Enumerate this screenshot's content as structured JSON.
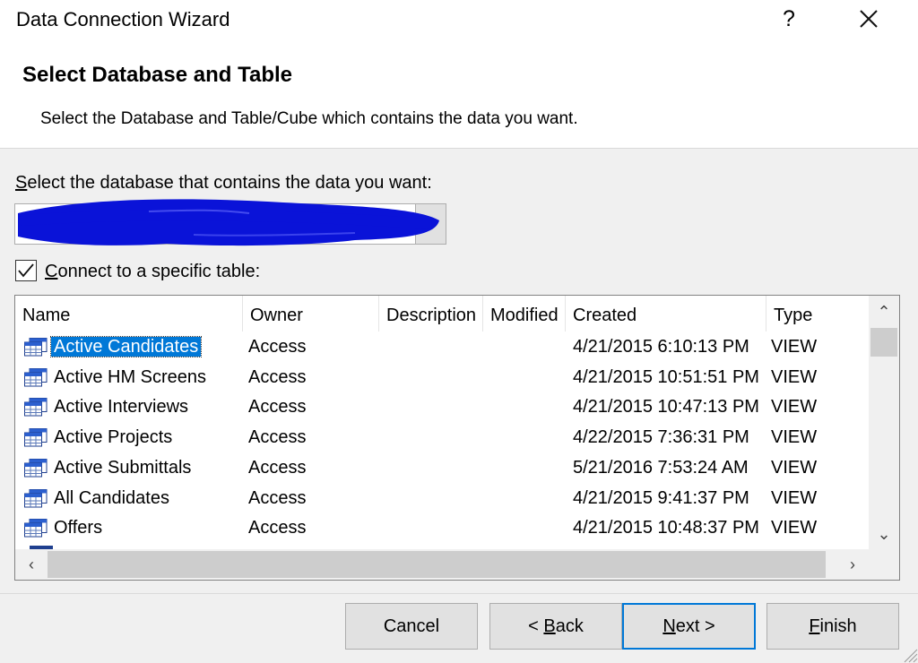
{
  "window": {
    "title": "Data Connection Wizard",
    "help_label": "?"
  },
  "header": {
    "title": "Select Database and Table",
    "subtitle": "Select the Database and Table/Cube which contains the data you want."
  },
  "database": {
    "label_underlined": "S",
    "label_rest": "elect the database that contains the data you want:",
    "selected_value": "",
    "redacted": true
  },
  "connect_specific": {
    "checked": true,
    "label_underlined": "C",
    "label_rest": "onnect to a specific table:"
  },
  "table_list": {
    "columns": [
      "Name",
      "Owner",
      "Description",
      "Modified",
      "Created",
      "Type"
    ],
    "rows": [
      {
        "name": "Active Candidates",
        "owner": "Access",
        "description": "",
        "modified": "",
        "created": "4/21/2015 6:10:13 PM",
        "type": "VIEW",
        "selected": true
      },
      {
        "name": "Active HM Screens",
        "owner": "Access",
        "description": "",
        "modified": "",
        "created": "4/21/2015 10:51:51 PM",
        "type": "VIEW"
      },
      {
        "name": "Active Interviews",
        "owner": "Access",
        "description": "",
        "modified": "",
        "created": "4/21/2015 10:47:13 PM",
        "type": "VIEW"
      },
      {
        "name": "Active Projects",
        "owner": "Access",
        "description": "",
        "modified": "",
        "created": "4/22/2015 7:36:31 PM",
        "type": "VIEW"
      },
      {
        "name": "Active Submittals",
        "owner": "Access",
        "description": "",
        "modified": "",
        "created": "5/21/2016 7:53:24 AM",
        "type": "VIEW"
      },
      {
        "name": "All Candidates",
        "owner": "Access",
        "description": "",
        "modified": "",
        "created": "4/21/2015 9:41:37 PM",
        "type": "VIEW"
      },
      {
        "name": "Offers",
        "owner": "Access",
        "description": "",
        "modified": "",
        "created": "4/21/2015 10:48:37 PM",
        "type": "VIEW"
      }
    ],
    "row_icon": "table-view-icon"
  },
  "buttons": {
    "cancel": {
      "label": "Cancel"
    },
    "back": {
      "prefix": "< ",
      "underlined": "B",
      "rest": "ack"
    },
    "next": {
      "underlined": "N",
      "rest": "ext >"
    },
    "finish": {
      "underlined": "F",
      "rest": "inish"
    }
  },
  "colors": {
    "selection": "#0078d7",
    "redaction": "#0a13d8",
    "dialog_bg": "#f0f0f0"
  }
}
